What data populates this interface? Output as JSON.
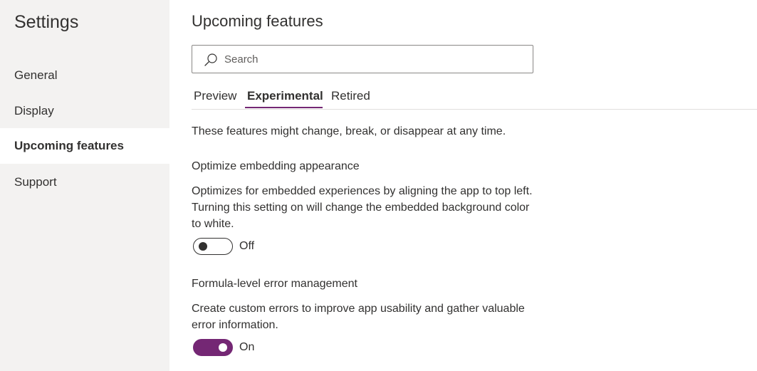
{
  "sidebar": {
    "title": "Settings",
    "items": [
      {
        "label": "General"
      },
      {
        "label": "Display"
      },
      {
        "label": "Upcoming features"
      },
      {
        "label": "Support"
      }
    ]
  },
  "main": {
    "title": "Upcoming features",
    "search": {
      "placeholder": "Search",
      "value": ""
    },
    "tabs": [
      {
        "label": "Preview"
      },
      {
        "label": "Experimental"
      },
      {
        "label": "Retired"
      }
    ],
    "selected_tab": "Experimental",
    "intro": "These features might change, break, or disappear at any time.",
    "features": [
      {
        "title": "Optimize embedding appearance",
        "description": "Optimizes for embedded experiences by aligning the app to top left. Turning this setting on will change the embedded background color to white.",
        "state_label": "Off",
        "enabled": false
      },
      {
        "title": "Formula-level error management",
        "description": "Create custom errors to improve app usability and gather valuable error information.",
        "state_label": "On",
        "enabled": true
      }
    ]
  },
  "colors": {
    "accent": "#742774",
    "sidebar_bg": "#f3f2f1",
    "text": "#323130"
  },
  "icons": {
    "search": "search-icon"
  }
}
